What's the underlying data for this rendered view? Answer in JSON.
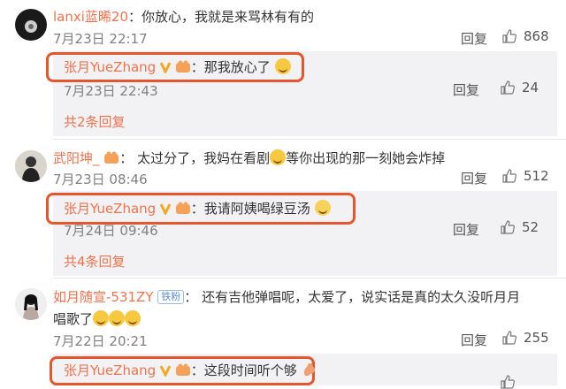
{
  "comments": [
    {
      "user": "lanxi蓝晞20",
      "text": "你放心，我就是来骂林有有的",
      "time": "7月23日 22:17",
      "reply_label": "回复",
      "likes": "868",
      "reply": {
        "user": "张月YueZhang",
        "sep": "：",
        "text": "那我放心了",
        "time": "7月23日 22:43",
        "reply_label": "回复",
        "likes": "24"
      },
      "more": "共2条回复"
    },
    {
      "user": "武阳坤_",
      "text_a": "太过分了，我妈在看剧",
      "text_b": "等你出现的那一刻她会炸掉",
      "time": "7月23日 08:46",
      "reply_label": "回复",
      "likes": "512",
      "reply": {
        "user": "张月YueZhang",
        "sep": "：",
        "text": "我请阿姨喝绿豆汤",
        "time": "7月24日 09:46",
        "reply_label": "回复",
        "likes": "52"
      },
      "more": "共4条回复"
    },
    {
      "user": "如月随宣-531ZY",
      "fan_badge": "铁粉",
      "text_line1": "还有吉他弹唱呢，太爱了，说实话是真的太久没听月月",
      "text_line2": "唱歌了",
      "time": "7月22日 20:21",
      "reply_label": "回复",
      "likes": "255",
      "reply": {
        "user": "张月YueZhang",
        "sep": "：",
        "text": "这段时间听个够"
      }
    }
  ],
  "separator": "：",
  "icons": [
    "avatar",
    "verified-v-icon",
    "level-badge-icon",
    "laugh-emoji-icon",
    "cry-emoji-icon",
    "thumbs-up-icon"
  ],
  "colors": {
    "username": "#eb7350",
    "highlight": "#e4572e",
    "reply_bg": "#f2f2f5"
  }
}
